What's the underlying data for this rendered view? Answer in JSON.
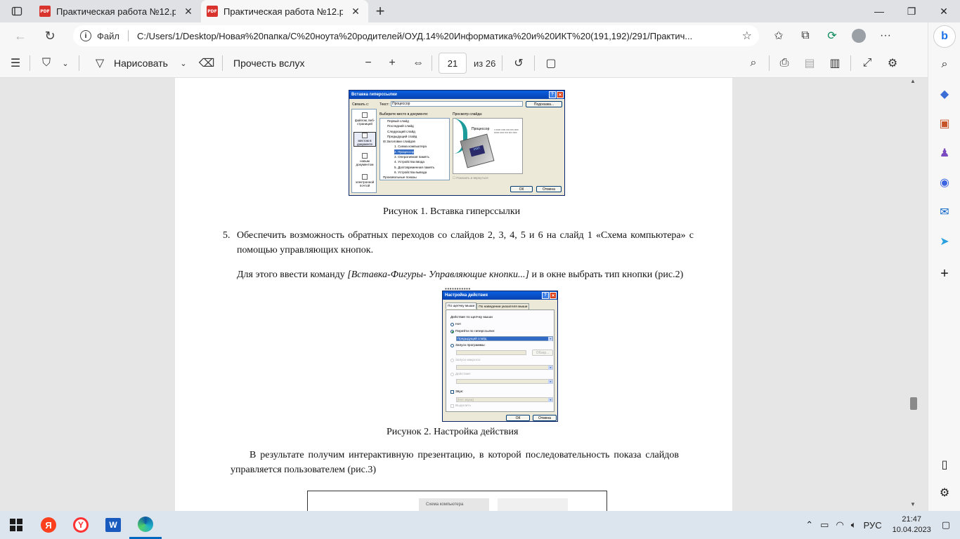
{
  "browser": {
    "tabs": [
      {
        "title": "Практическая работа №12.pdf",
        "active": false
      },
      {
        "title": "Практическая работа №12.pdf",
        "active": true
      }
    ],
    "address": {
      "file_label": "Файл",
      "url": "C:/Users/1/Desktop/Новая%20папка/С%20ноута%20родителей/ОУД.14%20Информатика%20и%20ИКТ%20(191,192)/291/Практич..."
    }
  },
  "pdf_toolbar": {
    "draw_label": "Нарисовать",
    "read_aloud_label": "Прочесть вслух",
    "current_page": "21",
    "page_of": "из 26"
  },
  "document": {
    "dialog1": {
      "title": "Вставка гиперссылки",
      "link_to_label": "Связать с:",
      "text_label": "Текст:",
      "text_value": "Процессор",
      "tooltip_button": "Подсказка...",
      "select_place_label": "Выберите место в документе:",
      "preview_label": "Просмотр слайда:",
      "left_items": [
        "файлом, веб-страницей",
        "местом в документе",
        "новым документом",
        "электронной почтой"
      ],
      "tree": [
        "Первый слайд",
        "Последний слайд",
        "Следующий слайд",
        "Предыдущий слайд",
        "Заголовки слайдов",
        "1. Схема компьютера",
        "2. Процессор",
        "3. Оперативная память",
        "4. Устройства ввода",
        "5. Долговременная память",
        "6. Устройства вывода",
        "Произвольные показы"
      ],
      "slide_title": "Процессор",
      "show_and_return": "Показать и вернуться",
      "ok": "ОК",
      "cancel": "Отмена"
    },
    "caption1": "Рисунок 1. Вставка гиперссылки",
    "item5_number": "5.",
    "item5_text": "Обеспечить возможность обратных переходов со слайдов 2, 3, 4, 5 и 6 на слайд 1 «Схема компьютера» с помощью управляющих кнопок.",
    "instruction_start": "Для этого ввести команду ",
    "instruction_command": "[Вставка-Фигуры- Управляющие кнопки...]",
    "instruction_end": " и в окне выбрать тип кнопки (рис.2)",
    "dialog2": {
      "title": "Настройка действия",
      "tab_click": "По щелчку мыши",
      "tab_hover": "По наведении указателя мыши",
      "group_label": "Действие по щелчку мыши",
      "opt_none": "Нет",
      "opt_hyperlink": "Перейти по гиперссылке:",
      "hyperlink_value": "Предыдущий слайд",
      "opt_program": "Запуск программы:",
      "browse": "Обзор...",
      "opt_macro": "Запуск макроса:",
      "opt_action": "Действие:",
      "sound_label": "Звук:",
      "sound_value": "[Нет звука]",
      "highlight_label": "Выделить",
      "ok": "ОК",
      "cancel": "Отмена"
    },
    "caption2": "Рисунок  2. Настройка действия",
    "result_text": "В результате получим интерактивную презентацию, в которой последовательность показа слайдов управляется пользователем (рис.3)",
    "fig3_label": "Схема компьютера"
  },
  "taskbar": {
    "language": "РУС",
    "time": "21:47",
    "date": "10.04.2023"
  }
}
